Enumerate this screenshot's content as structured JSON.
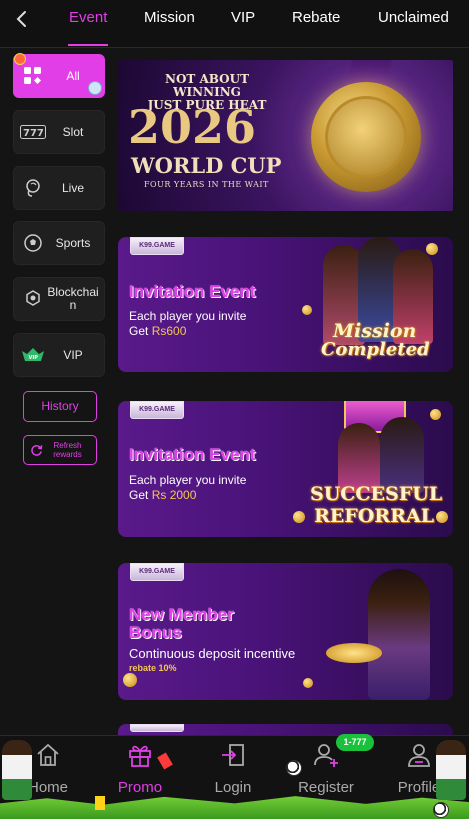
{
  "tabs": [
    {
      "label": "Event",
      "active": true
    },
    {
      "label": "Mission",
      "active": false
    },
    {
      "label": "VIP",
      "active": false
    },
    {
      "label": "Rebate",
      "active": false
    },
    {
      "label": "Unclaimed",
      "active": false
    }
  ],
  "sidebar": {
    "items": [
      {
        "label": "All",
        "icon": "grid-icon",
        "active": true
      },
      {
        "label": "Slot",
        "icon": "slot-777-icon",
        "active": false
      },
      {
        "label": "Live",
        "icon": "live-dealer-icon",
        "active": false
      },
      {
        "label": "Sports",
        "icon": "soccer-ball-icon",
        "active": false
      },
      {
        "label": "Blockchain",
        "icon": "blockchain-icon",
        "active": false
      },
      {
        "label": "VIP",
        "icon": "vip-crest-icon",
        "active": false
      }
    ],
    "history_label": "History",
    "refresh_label": "Refresh rewards"
  },
  "banners": {
    "worldcup": {
      "line1": "NOT ABOUT WINNING",
      "line2": "JUST PURE HEAT",
      "year": "2026",
      "title": "WORLD CUP",
      "tagline": "FOUR YEARS IN THE WAIT"
    },
    "invite1": {
      "tag": "K99.GAME",
      "title": "Invitation Event",
      "desc_line1": "Each player you invite",
      "desc_prefix": "Get ",
      "amount": "Rs600",
      "stamp_line1": "Mission",
      "stamp_line2": "Completed"
    },
    "invite2": {
      "tag": "K99.GAME",
      "title": "Invitation Event",
      "desc_line1": "Each player you invite",
      "desc_prefix": "Get ",
      "amount": "Rs 2000",
      "stamp_line1": "SUCCESFUL",
      "stamp_line2": "REFORRAL"
    },
    "newmember": {
      "tag": "K99.GAME",
      "title_line1": "New Member",
      "title_line2": "Bonus",
      "desc": "Continuous deposit incentive",
      "rebate": "rebate 10%"
    }
  },
  "bottom_nav": {
    "items": [
      {
        "label": "Home",
        "icon": "home-icon",
        "active": false
      },
      {
        "label": "Promo",
        "icon": "gift-icon",
        "active": true
      },
      {
        "label": "Login",
        "icon": "login-icon",
        "active": false
      },
      {
        "label": "Register",
        "icon": "add-user-icon",
        "active": false
      },
      {
        "label": "Profile",
        "icon": "profile-icon",
        "active": false
      }
    ],
    "register_badge": "1-777"
  },
  "colors": {
    "accent": "#e13ee7",
    "background": "#141414",
    "gold": "#f3c657",
    "badge_green": "#19c23a"
  }
}
